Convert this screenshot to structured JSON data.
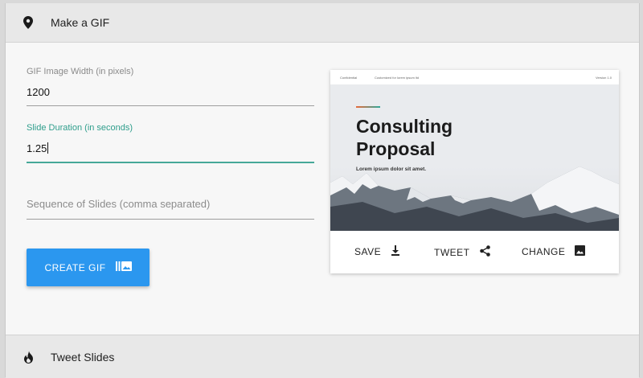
{
  "header": {
    "title": "Make a GIF",
    "icon": "location-pin-icon"
  },
  "form": {
    "width_field": {
      "label": "GIF Image Width (in pixels)",
      "value": "1200"
    },
    "duration_field": {
      "label": "Slide Duration (in seconds)",
      "value": "1.25"
    },
    "sequence_field": {
      "placeholder": "Sequence of Slides (comma separated)"
    },
    "create_button": {
      "label": "CREATE GIF",
      "icon": "gif-slides-icon"
    }
  },
  "preview": {
    "title_line1": "Consulting",
    "title_line2": "Proposal",
    "subtitle": "Lorem ipsum dolor sit amet.",
    "topbar_left": "Confidential",
    "topbar_center": "Customized for lorem ipsum ltd",
    "topbar_right": "Version 1.0",
    "accent_colors": [
      "#e86a3a",
      "#2fa89a"
    ]
  },
  "card_actions": {
    "save": {
      "label": "SAVE",
      "icon": "download-icon"
    },
    "tweet": {
      "label": "TWEET",
      "icon": "share-icon"
    },
    "change": {
      "label": "CHANGE",
      "icon": "image-icon"
    }
  },
  "footer": {
    "title": "Tweet Slides",
    "icon": "flame-icon"
  },
  "colors": {
    "primary": "#2b97ef",
    "focus": "#46a899"
  }
}
